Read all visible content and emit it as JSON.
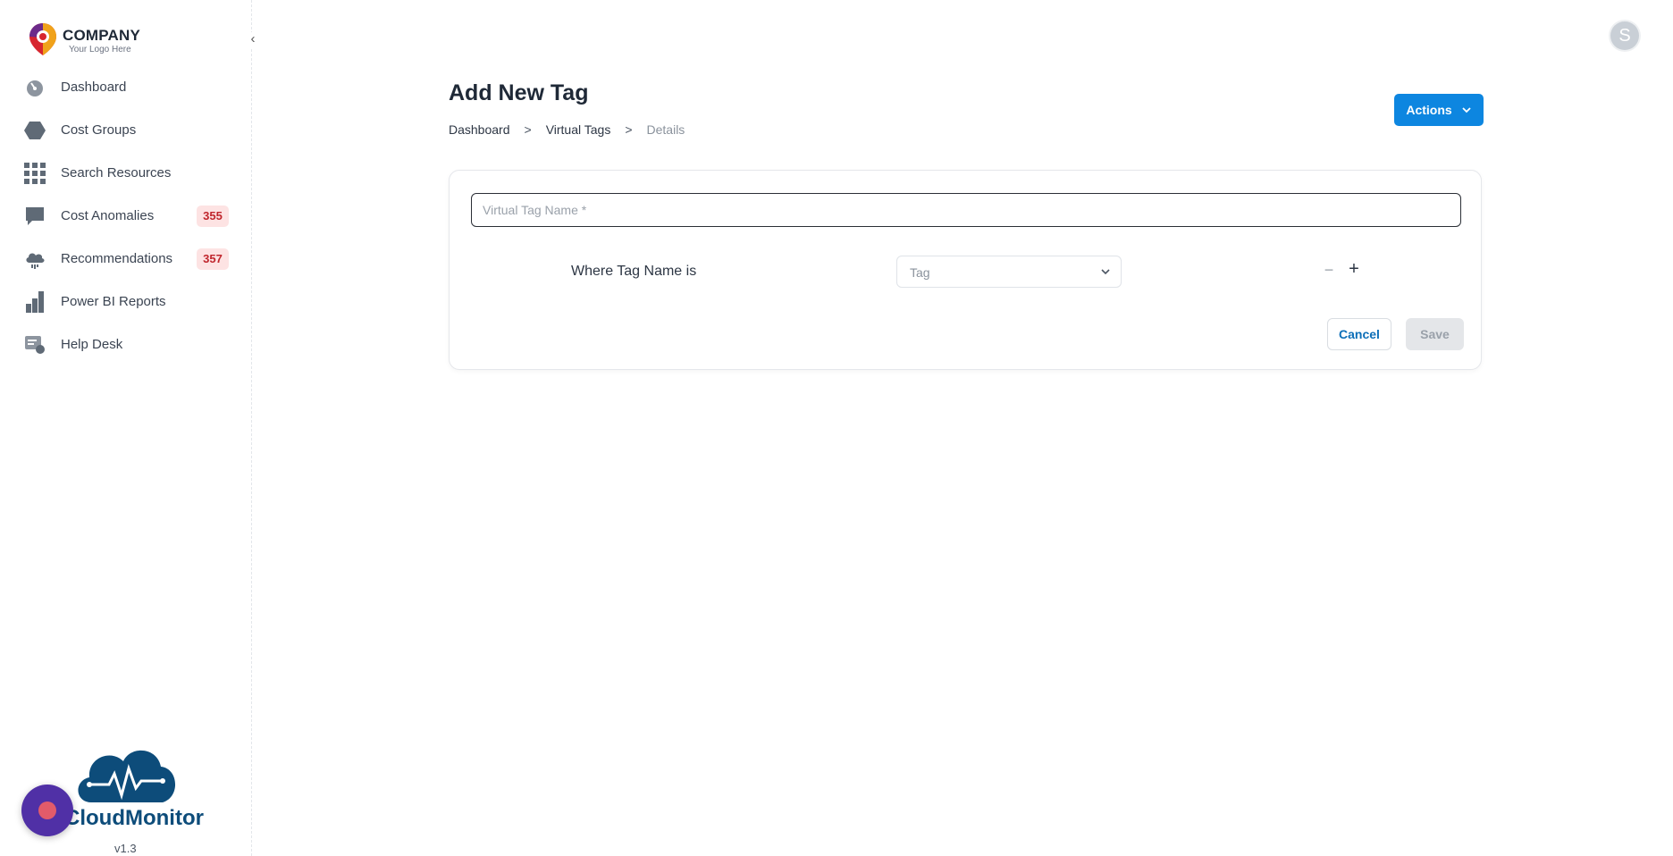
{
  "sidebar": {
    "logo": {
      "name": "COMPANY",
      "tagline": "Your Logo Here"
    },
    "collapse_icon": "chevron-left-icon",
    "items": [
      {
        "label": "Dashboard",
        "icon": "speedometer-icon"
      },
      {
        "label": "Cost Groups",
        "icon": "hexagon-icon"
      },
      {
        "label": "Search Resources",
        "icon": "grid-icon"
      },
      {
        "label": "Cost Anomalies",
        "icon": "chat-bubble-icon",
        "badge": "355"
      },
      {
        "label": "Recommendations",
        "icon": "cloud-icon",
        "badge": "357"
      },
      {
        "label": "Power BI Reports",
        "icon": "bar-chart-icon"
      },
      {
        "label": "Help Desk",
        "icon": "help-desk-icon"
      }
    ],
    "brand": {
      "text": "CloudMonitor"
    },
    "version": "v1.3"
  },
  "header": {
    "avatar_initial": "S",
    "title": "Add New Tag",
    "breadcrumb": {
      "items": [
        "Dashboard",
        "Virtual Tags"
      ],
      "current": "Details",
      "separator": ">"
    },
    "actions_label": "Actions"
  },
  "form": {
    "name_placeholder": "Virtual Tag Name *",
    "name_value": "",
    "rule_label": "Where Tag Name is",
    "tag_select_value": "Tag",
    "minus_symbol": "−",
    "plus_symbol": "+",
    "cancel_label": "Cancel",
    "save_label": "Save"
  },
  "colors": {
    "primary": "#0d86e0",
    "badge_bg": "#fde3e3",
    "badge_text": "#c0262d",
    "brand_dark": "#0d4c7a",
    "chat_fab": "#5030a6"
  }
}
